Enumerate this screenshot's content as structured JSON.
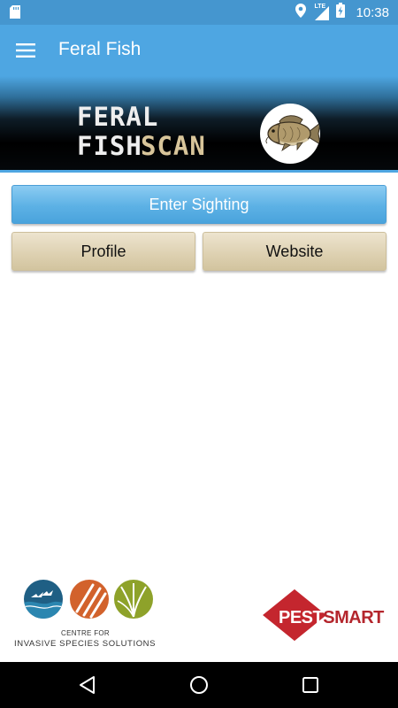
{
  "status_bar": {
    "time": "10:38",
    "network_label": "LTE",
    "icons": [
      "sd-card-icon",
      "location-icon",
      "signal-icon",
      "battery-charging-icon"
    ]
  },
  "app_bar": {
    "title": "Feral Fish",
    "menu_icon": "hamburger-menu-icon"
  },
  "banner": {
    "logo_line1": "FERAL",
    "logo_line2a": "FISH",
    "logo_line2b": "SCAN",
    "fish_icon": "carp-fish-icon"
  },
  "actions": {
    "enter_sighting": "Enter Sighting",
    "profile": "Profile",
    "website": "Website"
  },
  "footer": {
    "cis_centre_for": "CENTRE FOR",
    "cis_name": "INVASIVE SPECIES SOLUTIONS",
    "pestsmart_a": "PEST",
    "pestsmart_b": "SMART"
  },
  "colors": {
    "status_bar": "#4596cf",
    "app_bar": "#4ea6e2",
    "primary_button": "#5cb1e5",
    "secondary_button": "#ddd0b0",
    "pestsmart_red": "#c4262e"
  },
  "nav": {
    "back_icon": "back-triangle-icon",
    "home_icon": "home-circle-icon",
    "recents_icon": "recents-square-icon"
  }
}
